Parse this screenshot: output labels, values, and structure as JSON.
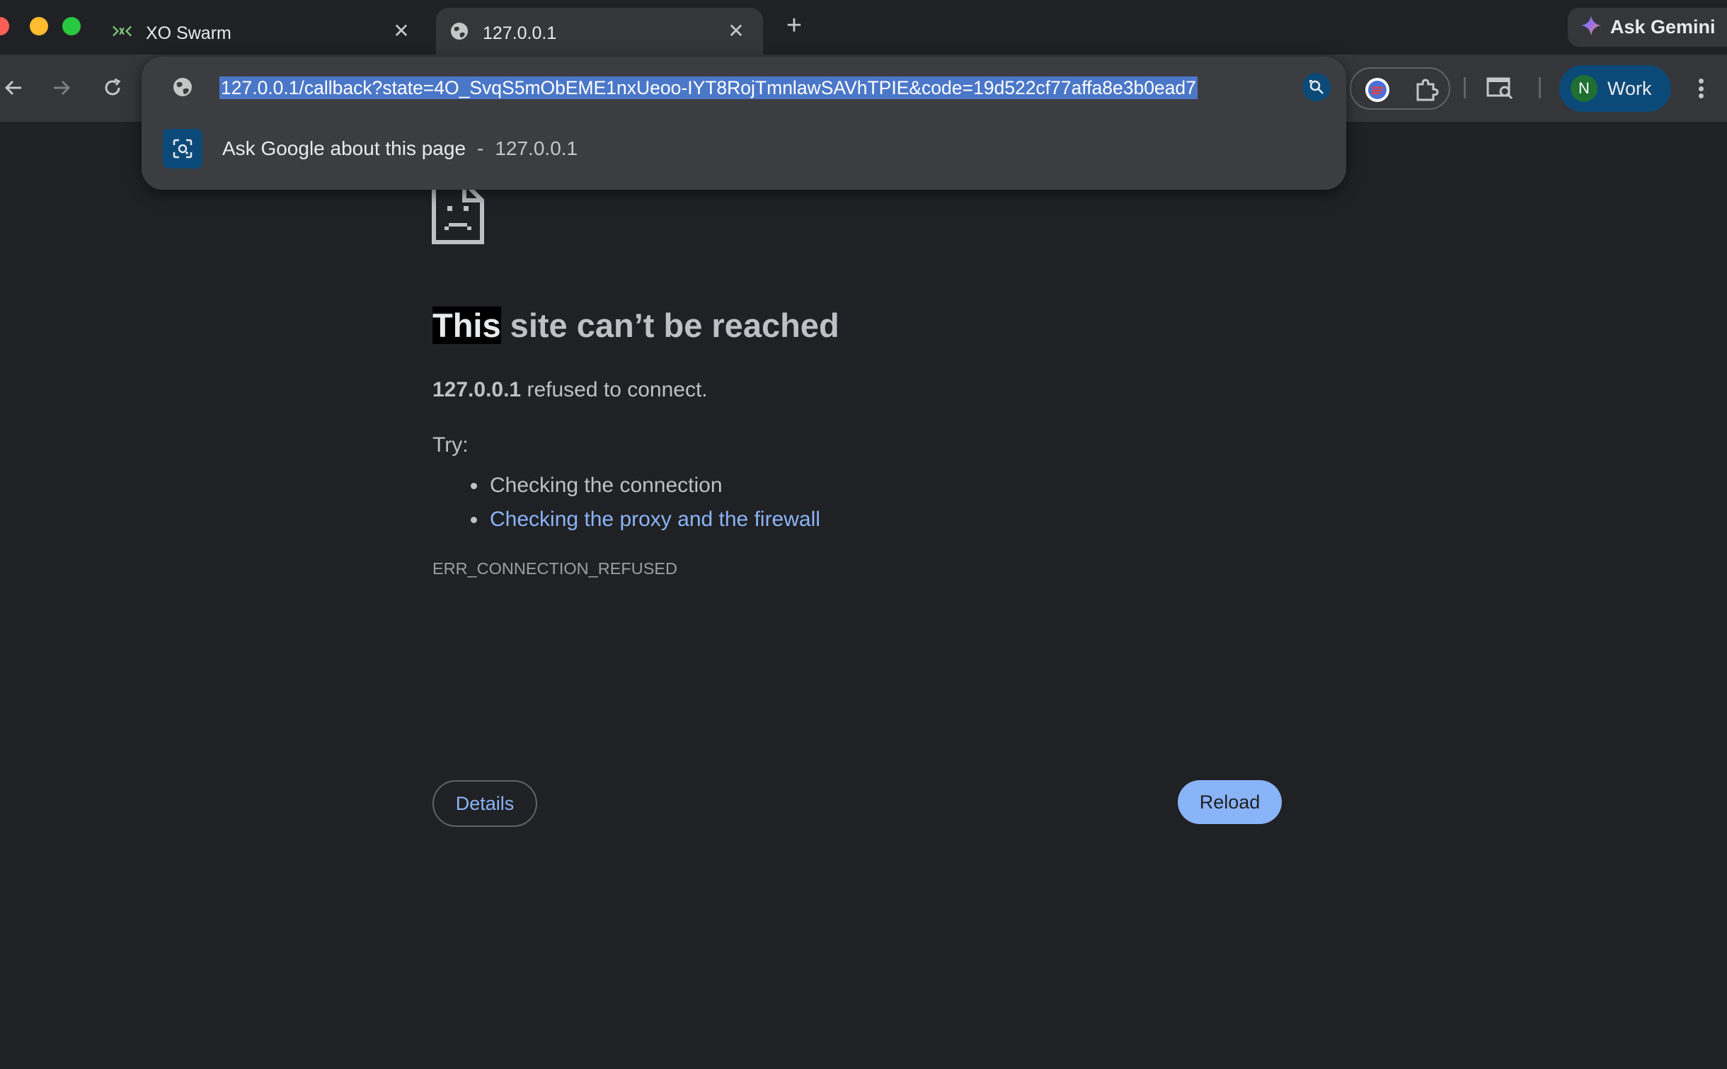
{
  "window": {
    "controls": [
      "close",
      "minimize",
      "zoom"
    ]
  },
  "tabs": [
    {
      "title": "XO Swarm",
      "icon": "xo-swarm-icon",
      "active": false
    },
    {
      "title": "127.0.0.1",
      "icon": "globe-icon",
      "active": true
    }
  ],
  "tab_close_glyph": "✕",
  "new_tab_glyph": "+",
  "gemini": {
    "label": "Ask Gemini",
    "icon": "gemini-sparkle-icon"
  },
  "omnibox": {
    "url": "127.0.0.1/callback?state=4O_SvqS5mObEME1nxUeoo-IYT8RojTmnlawSAVhTPIE&code=19d522cf77affa8e3b0ead7",
    "suggestion": {
      "text": "Ask Google about this page",
      "separator": "-",
      "host": "127.0.0.1"
    }
  },
  "profile": {
    "initial": "N",
    "label": "Work",
    "avatar_color": "#1f6f33"
  },
  "error_page": {
    "heading_highlight": "This",
    "heading_rest": " site can’t be reached",
    "host": "127.0.0.1",
    "refused_rest": " refused to connect.",
    "try_label": "Try:",
    "tips": [
      "Checking the connection",
      "Checking the proxy and the firewall"
    ],
    "error_code": "ERR_CONNECTION_REFUSED",
    "details_label": "Details",
    "reload_label": "Reload"
  },
  "colors": {
    "background": "#202124",
    "toolbar": "#35363a",
    "link": "#8ab4f8",
    "url_selection": "#4b77c8",
    "profile_chip": "#0b4a78"
  }
}
